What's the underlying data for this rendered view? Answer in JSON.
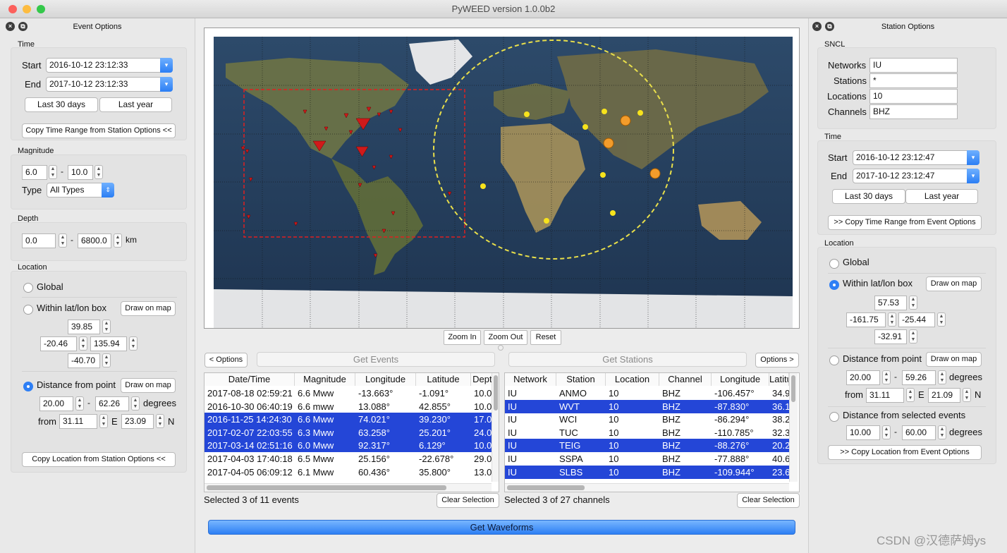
{
  "window": {
    "title": "PyWEED version 1.0.0b2"
  },
  "event_options": {
    "header": "Event Options",
    "time": {
      "label": "Time",
      "start_label": "Start",
      "start": "2016-10-12 23:12:33",
      "end_label": "End",
      "end": "2017-10-12 23:12:33",
      "last30": "Last 30 days",
      "lastyear": "Last year",
      "copy": "Copy Time Range from Station Options <<"
    },
    "magnitude": {
      "label": "Magnitude",
      "min": "6.0",
      "dash": "-",
      "max": "10.0",
      "type_label": "Type",
      "type": "All Types"
    },
    "depth": {
      "label": "Depth",
      "min": "0.0",
      "dash": "-",
      "max": "6800.0",
      "unit": "km"
    },
    "location": {
      "label": "Location",
      "global": "Global",
      "box": "Within lat/lon box",
      "draw": "Draw on map",
      "north": "39.85",
      "west": "-20.46",
      "east": "135.94",
      "south": "-40.70",
      "distance": "Distance from point",
      "dmin": "20.00",
      "dash": "-",
      "dmax": "62.26",
      "degrees": "degrees",
      "from": "from",
      "lat": "31.11",
      "e": "E",
      "lon": "23.09",
      "n": "N",
      "copy": "Copy Location from Station Options <<"
    }
  },
  "station_options": {
    "header": "Station Options",
    "sncl": {
      "label": "SNCL",
      "networks_label": "Networks",
      "networks": "IU",
      "stations_label": "Stations",
      "stations": "*",
      "locations_label": "Locations",
      "locations": "10",
      "channels_label": "Channels",
      "channels": "BHZ"
    },
    "time": {
      "label": "Time",
      "start_label": "Start",
      "start": "2016-10-12 23:12:47",
      "end_label": "End",
      "end": "2017-10-12 23:12:47",
      "last30": "Last 30 days",
      "lastyear": "Last year",
      "copy": ">> Copy Time Range from Event Options"
    },
    "location": {
      "label": "Location",
      "global": "Global",
      "box": "Within lat/lon box",
      "draw": "Draw on map",
      "north": "57.53",
      "west": "-161.75",
      "east": "-25.44",
      "south": "-32.91",
      "distance": "Distance from point",
      "dmin": "20.00",
      "dash": "-",
      "dmax": "59.26",
      "degrees": "degrees",
      "from": "from",
      "lat": "31.11",
      "e": "E",
      "lon": "21.09",
      "n": "N",
      "sel_events": "Distance from selected events",
      "emin": "10.00",
      "emax": "60.00",
      "copy": ">> Copy Location from Event Options"
    }
  },
  "map": {
    "zoom_in": "Zoom In",
    "zoom_out": "Zoom Out",
    "reset": "Reset",
    "colors": {
      "ocean": "#223a55",
      "land": "#5b6a3e",
      "desert": "#b5a477",
      "ice": "#f2f2f2",
      "event": "#d01a1a",
      "station": "#f7e31c",
      "event_box": "#e02020",
      "station_circle": "#e9df4a"
    }
  },
  "controls": {
    "options_left": "< Options",
    "get_events": "Get Events",
    "get_stations": "Get Stations",
    "options_right": "Options >",
    "get_waveforms": "Get Waveforms"
  },
  "events_table": {
    "columns": [
      "Date/Time",
      "Magnitude",
      "Longitude",
      "Latitude",
      "Depth"
    ],
    "rows": [
      {
        "cells": [
          "2017-08-18 02:59:21",
          "6.6 Mww",
          "-13.663°",
          "-1.091°",
          "10.0"
        ],
        "selected": false
      },
      {
        "cells": [
          "2016-10-30 06:40:19",
          "6.6 mww",
          "13.088°",
          "42.855°",
          "10.0"
        ],
        "selected": false
      },
      {
        "cells": [
          "2016-11-25 14:24:30",
          "6.6 Mww",
          "74.021°",
          "39.230°",
          "17.0"
        ],
        "selected": true
      },
      {
        "cells": [
          "2017-02-07 22:03:55",
          "6.3 Mww",
          "63.258°",
          "25.201°",
          "24.0"
        ],
        "selected": true
      },
      {
        "cells": [
          "2017-03-14 02:51:16",
          "6.0 Mww",
          "92.317°",
          "6.129°",
          "10.0"
        ],
        "selected": true
      },
      {
        "cells": [
          "2017-04-03 17:40:18",
          "6.5 Mww",
          "25.156°",
          "-22.678°",
          "29.0"
        ],
        "selected": false
      },
      {
        "cells": [
          "2017-04-05 06:09:12",
          "6.1 Mww",
          "60.436°",
          "35.800°",
          "13.0"
        ],
        "selected": false
      }
    ],
    "status": "Selected 3 of 11 events",
    "clear": "Clear Selection"
  },
  "stations_table": {
    "columns": [
      "Network",
      "Station",
      "Location",
      "Channel",
      "Longitude",
      "Latitude"
    ],
    "rows": [
      {
        "cells": [
          "IU",
          "ANMO",
          "10",
          "BHZ",
          "-106.457°",
          "34.9"
        ],
        "selected": false
      },
      {
        "cells": [
          "IU",
          "WVT",
          "10",
          "BHZ",
          "-87.830°",
          "36.1"
        ],
        "selected": true
      },
      {
        "cells": [
          "IU",
          "WCI",
          "10",
          "BHZ",
          "-86.294°",
          "38.2"
        ],
        "selected": false
      },
      {
        "cells": [
          "IU",
          "TUC",
          "10",
          "BHZ",
          "-110.785°",
          "32.3"
        ],
        "selected": false
      },
      {
        "cells": [
          "IU",
          "TEIG",
          "10",
          "BHZ",
          "-88.276°",
          "20.2"
        ],
        "selected": true
      },
      {
        "cells": [
          "IU",
          "SSPA",
          "10",
          "BHZ",
          "-77.888°",
          "40.6"
        ],
        "selected": false
      },
      {
        "cells": [
          "IU",
          "SLBS",
          "10",
          "BHZ",
          "-109.944°",
          "23.6"
        ],
        "selected": true
      }
    ],
    "status": "Selected 3 of 27 channels",
    "clear": "Clear Selection"
  },
  "watermark": "CSDN @汉德萨姆ys"
}
